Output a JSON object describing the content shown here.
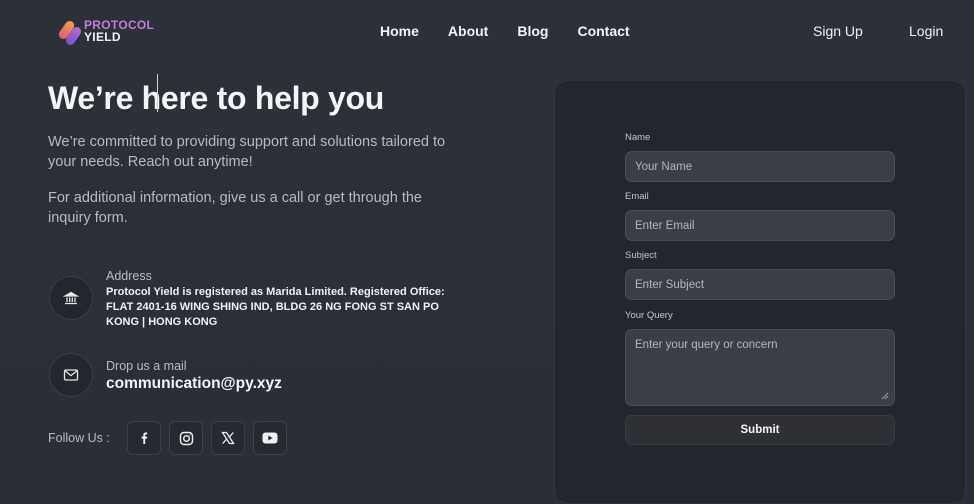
{
  "brand": {
    "line1": "PROTOCOL",
    "line2": "YIELD"
  },
  "nav": {
    "links": [
      "Home",
      "About",
      "Blog",
      "Contact"
    ],
    "signup": "Sign Up",
    "login": "Login"
  },
  "hero": {
    "title": "We’re here to help you",
    "para1": "We’re committed to providing support and solutions tailored to your needs. Reach out anytime!",
    "para2": "For additional information, give us a call or get through the inquiry form."
  },
  "address": {
    "label": "Address",
    "text": "Protocol Yield is registered as Marida Limited. Registered Office: FLAT 2401-16 WING SHING IND, BLDG 26 NG FONG ST SAN PO KONG | HONG KONG",
    "icon": "bank-icon"
  },
  "mail": {
    "label": "Drop us a mail",
    "value": "communication@py.xyz",
    "icon": "mail-icon"
  },
  "follow": {
    "label": "Follow Us :",
    "icons": [
      "facebook-icon",
      "instagram-icon",
      "x-icon",
      "youtube-icon"
    ]
  },
  "form": {
    "name_label": "Name",
    "name_placeholder": "Your Name",
    "email_label": "Email",
    "email_placeholder": "Enter Email",
    "subject_label": "Subject",
    "subject_placeholder": "Enter Subject",
    "query_label": "Your Query",
    "query_placeholder": "Enter your query or concern",
    "submit_label": "Submit"
  }
}
